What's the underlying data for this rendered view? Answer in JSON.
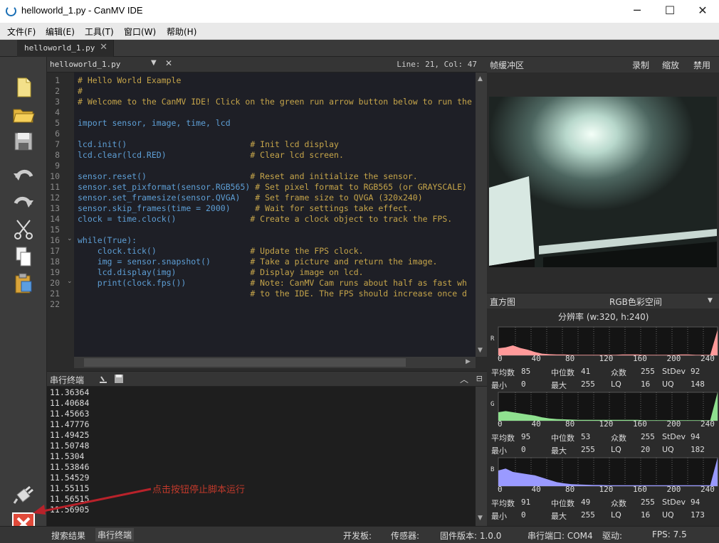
{
  "window": {
    "title": "helloworld_1.py - CanMV IDE",
    "min": "─",
    "max": "☐",
    "close": "✕"
  },
  "menu": [
    "文件(F)",
    "编辑(E)",
    "工具(T)",
    "窗口(W)",
    "帮助(H)"
  ],
  "tab": {
    "label": "helloworld_1.py",
    "close": "✕"
  },
  "editor": {
    "file": "helloworld_1.py",
    "cursor": "Line: 21, Col: 47",
    "lines": [
      {
        "n": "1",
        "t": "# Hello World Example",
        "c": "cm"
      },
      {
        "n": "2",
        "t": "#",
        "c": "cm"
      },
      {
        "n": "3",
        "t": "# Welcome to the CanMV IDE! Click on the green run arrow button below to run the",
        "c": "cm"
      },
      {
        "n": "4",
        "t": "",
        "c": ""
      },
      {
        "n": "5",
        "t": "import sensor, image, time, lcd",
        "c": "kw"
      },
      {
        "n": "6",
        "t": "",
        "c": ""
      },
      {
        "n": "7",
        "t": "lcd.init()                         # Init lcd display",
        "c": "mix"
      },
      {
        "n": "8",
        "t": "lcd.clear(lcd.RED)                 # Clear lcd screen.",
        "c": "mix"
      },
      {
        "n": "9",
        "t": "",
        "c": ""
      },
      {
        "n": "10",
        "t": "sensor.reset()                     # Reset and initialize the sensor.",
        "c": "mix"
      },
      {
        "n": "11",
        "t": "sensor.set_pixformat(sensor.RGB565) # Set pixel format to RGB565 (or GRAYSCALE)",
        "c": "mix"
      },
      {
        "n": "12",
        "t": "sensor.set_framesize(sensor.QVGA)   # Set frame size to QVGA (320x240)",
        "c": "mix"
      },
      {
        "n": "13",
        "t": "sensor.skip_frames(time = 2000)     # Wait for settings take effect.",
        "c": "mix"
      },
      {
        "n": "14",
        "t": "clock = time.clock()               # Create a clock object to track the FPS.",
        "c": "mix"
      },
      {
        "n": "15",
        "t": "",
        "c": ""
      },
      {
        "n": "16",
        "t": "while(True):",
        "c": "kw"
      },
      {
        "n": "17",
        "t": "    clock.tick()                   # Update the FPS clock.",
        "c": "mix"
      },
      {
        "n": "18",
        "t": "    img = sensor.snapshot()        # Take a picture and return the image.",
        "c": "mix"
      },
      {
        "n": "19",
        "t": "    lcd.display(img)               # Display image on lcd.",
        "c": "mix"
      },
      {
        "n": "20",
        "t": "    print(clock.fps())             # Note: CanMV Cam runs about half as fast wh",
        "c": "mix"
      },
      {
        "n": "21",
        "t": "                                   # to the IDE. The FPS should increase once d",
        "c": "cm"
      },
      {
        "n": "22",
        "t": "",
        "c": ""
      }
    ]
  },
  "serial": {
    "title": "串行终端",
    "lines": [
      "11.36364",
      "11.40684",
      "11.45663",
      "11.47776",
      "11.49425",
      "11.50748",
      "11.5304",
      "11.53846",
      "11.54529",
      "11.55115",
      "11.56515",
      "11.56905"
    ]
  },
  "framebuffer": {
    "title": "帧缓冲区",
    "record": "录制",
    "zoom": "缩放",
    "disable": "禁用"
  },
  "histogram": {
    "title": "直方图",
    "colorspace": "RGB色彩空间",
    "resolution": "分辨率 (w:320, h:240)",
    "ticks": [
      "0",
      "40",
      "80",
      "120",
      "160",
      "200",
      "240"
    ],
    "labels": {
      "mean": "平均数",
      "median": "中位数",
      "mode": "众数",
      "stdev": "StDev",
      "min": "最小",
      "max": "最大",
      "lq": "LQ",
      "uq": "UQ"
    },
    "channels": [
      {
        "name": "R",
        "color": "#ff9a9a",
        "mean": "85",
        "median": "41",
        "mode": "255",
        "stdev": "92",
        "min": "0",
        "max": "255",
        "lq": "16",
        "uq": "148"
      },
      {
        "name": "G",
        "color": "#8fe08f",
        "mean": "95",
        "median": "53",
        "mode": "255",
        "stdev": "94",
        "min": "0",
        "max": "255",
        "lq": "20",
        "uq": "182"
      },
      {
        "name": "B",
        "color": "#9a9aff",
        "mean": "91",
        "median": "49",
        "mode": "255",
        "stdev": "94",
        "min": "0",
        "max": "255",
        "lq": "16",
        "uq": "173"
      }
    ]
  },
  "annotation": "点击按钮停止脚本运行",
  "status": {
    "search": "搜索结果",
    "serial": "串行终端",
    "board": "开发板:",
    "sensor": "传感器:",
    "firmware": "固件版本: 1.0.0",
    "port": "串行端口: COM4",
    "driver": "驱动:",
    "fps": "FPS:  7.5"
  }
}
